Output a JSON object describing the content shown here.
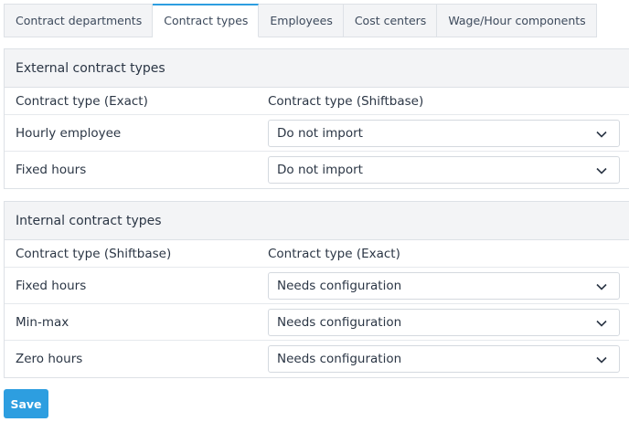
{
  "tabs": [
    {
      "label": "Contract departments",
      "active": false
    },
    {
      "label": "Contract types",
      "active": true
    },
    {
      "label": "Employees",
      "active": false
    },
    {
      "label": "Cost centers",
      "active": false
    },
    {
      "label": "Wage/Hour components",
      "active": false
    }
  ],
  "external": {
    "title": "External contract types",
    "col_left": "Contract type (Exact)",
    "col_right": "Contract type (Shiftbase)",
    "rows": [
      {
        "label": "Hourly employee",
        "value": "Do not import"
      },
      {
        "label": "Fixed hours",
        "value": "Do not import"
      }
    ]
  },
  "internal": {
    "title": "Internal contract types",
    "col_left": "Contract type (Shiftbase)",
    "col_right": "Contract type (Exact)",
    "rows": [
      {
        "label": "Fixed hours",
        "value": "Needs configuration"
      },
      {
        "label": "Min-max",
        "value": "Needs configuration"
      },
      {
        "label": "Zero hours",
        "value": "Needs configuration"
      }
    ]
  },
  "save_label": "Save",
  "colors": {
    "accent": "#2d9ee0",
    "panel_header_bg": "#f3f4f6",
    "border": "#dde1e6"
  },
  "icons": {
    "select_caret": "chevron-down-icon"
  }
}
